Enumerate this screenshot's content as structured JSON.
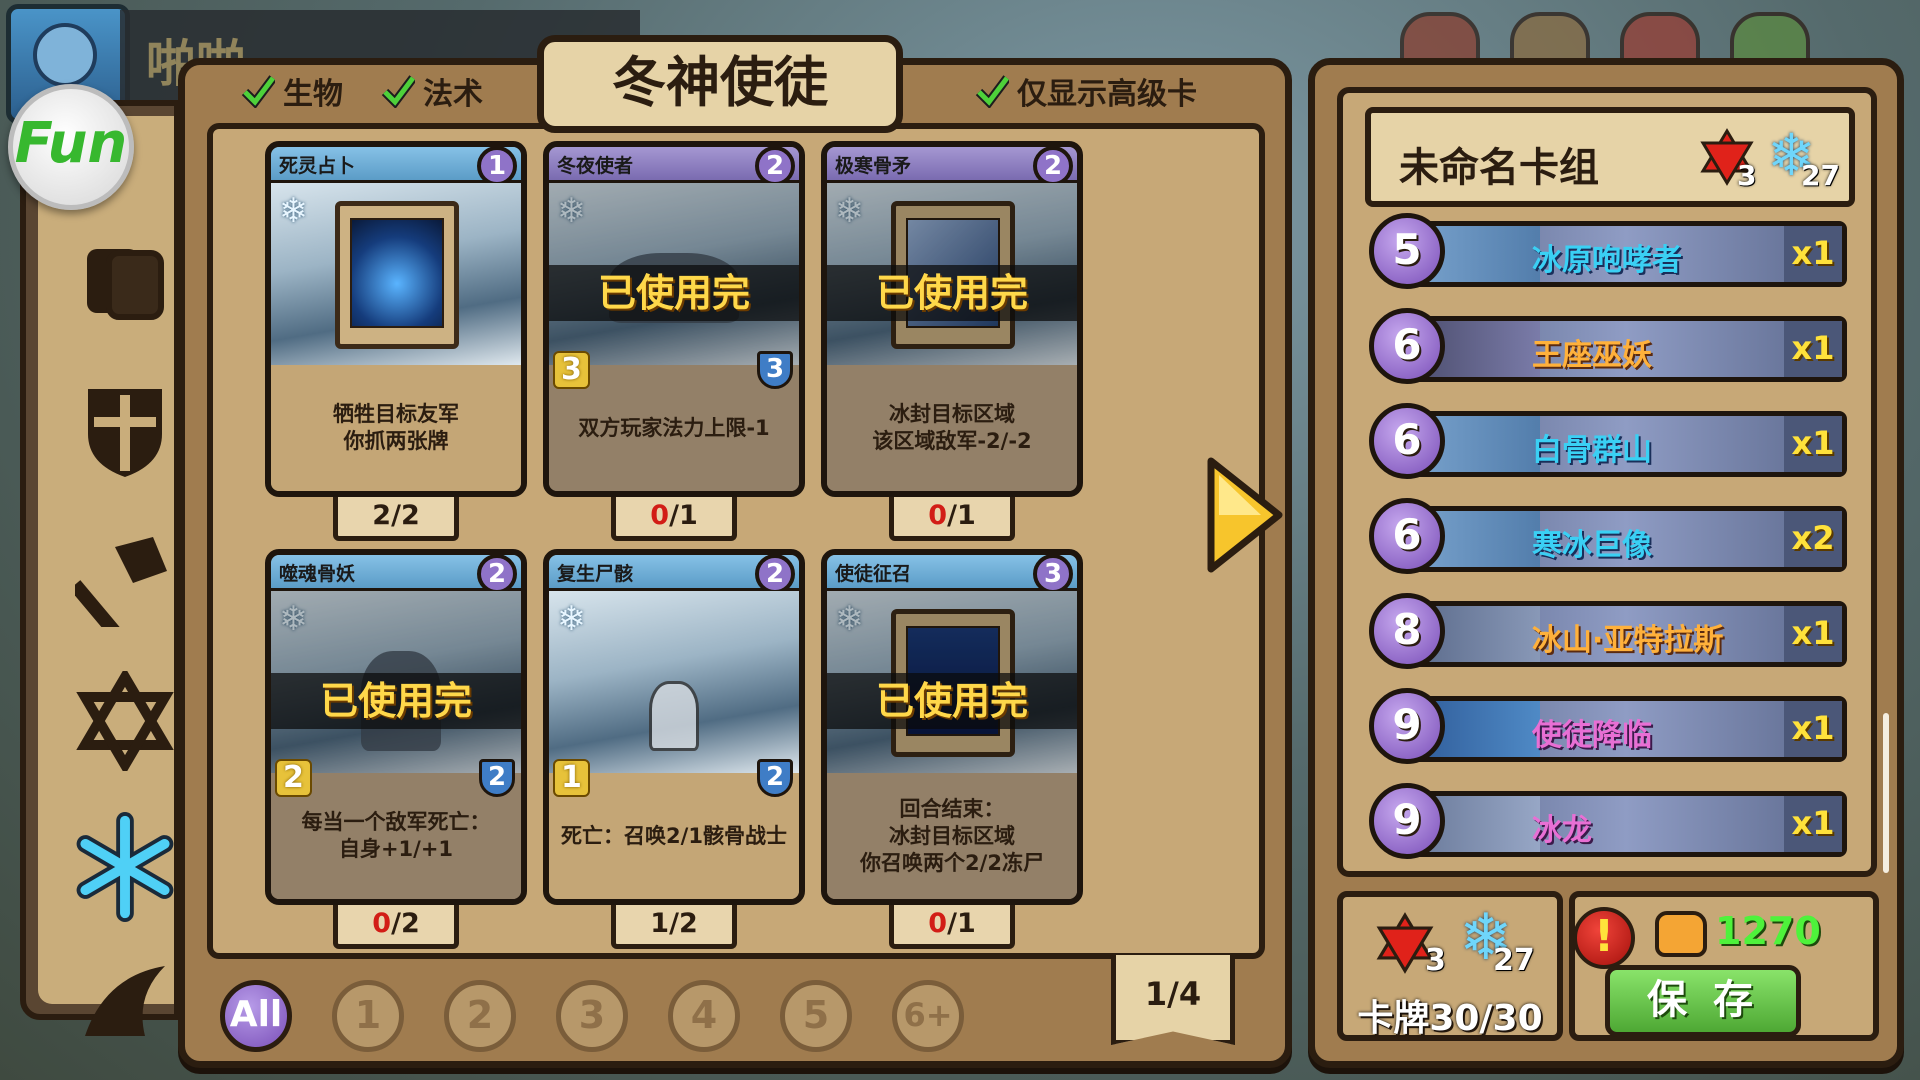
{
  "header": {
    "player_name": "啪啪"
  },
  "filters": {
    "creature": "生物",
    "spell": "法术",
    "only_advanced": "仅显示高级卡"
  },
  "panel_title": "冬神使徒",
  "cards": [
    {
      "name": "死灵占卜",
      "cost": "1",
      "text": "牺牲目标友军\n你抓两张牌",
      "used_label": "",
      "attack": "",
      "health": "",
      "count_have": "2",
      "count_sep": "/",
      "count_max": "2",
      "zero": false
    },
    {
      "name": "冬夜使者",
      "cost": "2",
      "text": "双方玩家法力上限-1",
      "used_label": "已使用完",
      "attack": "3",
      "health": "3",
      "count_have": "0",
      "count_sep": "/",
      "count_max": "1",
      "zero": true
    },
    {
      "name": "极寒骨矛",
      "cost": "2",
      "text": "冰封目标区域\n该区域敌军-2/-2",
      "used_label": "已使用完",
      "attack": "",
      "health": "",
      "count_have": "0",
      "count_sep": "/",
      "count_max": "1",
      "zero": true
    },
    {
      "name": "噬魂骨妖",
      "cost": "2",
      "text": "每当一个敌军死亡：\n自身+1/+1",
      "used_label": "已使用完",
      "attack": "2",
      "health": "2",
      "count_have": "0",
      "count_sep": "/",
      "count_max": "2",
      "zero": true
    },
    {
      "name": "复生尸骸",
      "cost": "2",
      "text": "死亡：召唤2/1骸骨战士",
      "used_label": "",
      "attack": "1",
      "health": "2",
      "count_have": "1",
      "count_sep": "/",
      "count_max": "2",
      "zero": false
    },
    {
      "name": "使徒征召",
      "cost": "3",
      "text": "回合结束：\n冰封目标区域\n你召唤两个2/2冻尸",
      "used_label": "已使用完",
      "attack": "",
      "health": "",
      "count_have": "0",
      "count_sep": "/",
      "count_max": "1",
      "zero": true
    }
  ],
  "cost_filters": [
    "All",
    "1",
    "2",
    "3",
    "4",
    "5",
    "6+"
  ],
  "page_indicator": "1/4",
  "deck": {
    "name": "未命名卡组",
    "red_count": "3",
    "ice_count": "27",
    "entries": [
      {
        "cost": "5",
        "name": "冰原咆哮者",
        "qty": "x1",
        "style": "blue"
      },
      {
        "cost": "6",
        "name": "王座巫妖",
        "qty": "x1",
        "style": "orange"
      },
      {
        "cost": "6",
        "name": "白骨群山",
        "qty": "x1",
        "style": "blue"
      },
      {
        "cost": "6",
        "name": "寒冰巨像",
        "qty": "x2",
        "style": "blue"
      },
      {
        "cost": "8",
        "name": "冰山·亚特拉斯",
        "qty": "x1",
        "style": "orange"
      },
      {
        "cost": "9",
        "name": "使徒降临",
        "qty": "x1",
        "style": "pink"
      },
      {
        "cost": "9",
        "name": "冰龙",
        "qty": "x1",
        "style": "pink"
      }
    ]
  },
  "summary": {
    "red_count": "3",
    "ice_count": "27",
    "card_count": "卡牌30/30"
  },
  "currency": {
    "value": "1270"
  },
  "save_label": "保 存",
  "colors": {
    "panel": "#a07c4f",
    "inner": "#c7a877",
    "accent_purple": "#7a4fb8",
    "warning_red": "#d21d16",
    "save_green": "#4ea834"
  }
}
